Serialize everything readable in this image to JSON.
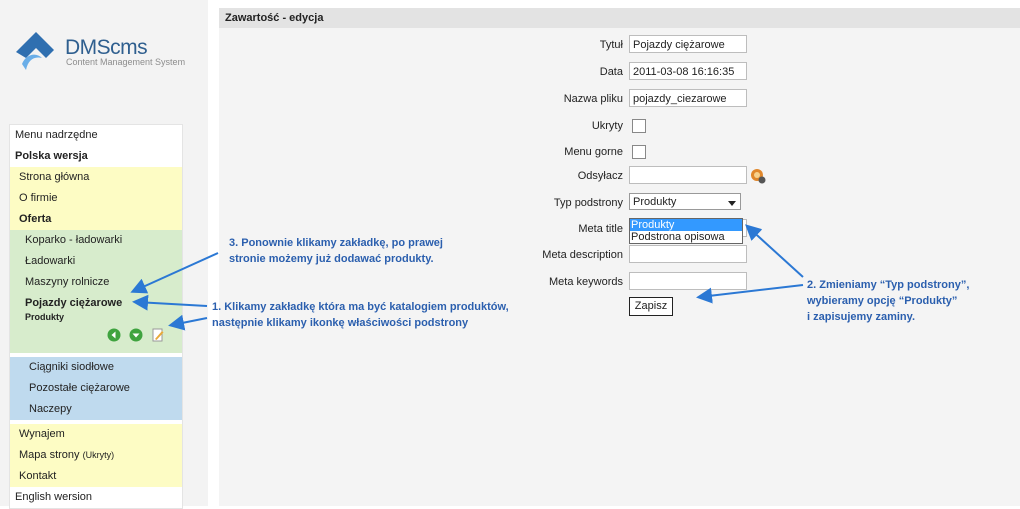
{
  "logo": {
    "name": "DMScms",
    "tagline": "Content Management System"
  },
  "menu": {
    "parent": "Menu nadrzędne",
    "section": "Polska wersja",
    "items_top": [
      {
        "label": "Strona główna"
      },
      {
        "label": "O firmie"
      }
    ],
    "oferta": "Oferta",
    "oferta_items": [
      {
        "label": "Koparko - ładowarki"
      },
      {
        "label": "Ładowarki"
      },
      {
        "label": "Maszyny rolnicze"
      }
    ],
    "selected": {
      "label": "Pojazdy ciężarowe",
      "sub": "Produkty"
    },
    "sub_items": [
      {
        "label": "Ciągniki siodłowe"
      },
      {
        "label": "Pozostałe ciężarowe"
      },
      {
        "label": "Naczepy"
      }
    ],
    "items_bottom": [
      {
        "label": "Wynajem"
      },
      {
        "label": "Mapa strony"
      },
      {
        "label": "Kontakt"
      }
    ],
    "hidden_note": "(Ukryty)",
    "english": "English wersion"
  },
  "form": {
    "header": "Zawartość - edycja",
    "fields": {
      "title_label": "Tytuł",
      "title_value": "Pojazdy ciężarowe",
      "date_label": "Data",
      "date_value": "2011-03-08 16:16:35",
      "file_label": "Nazwa pliku",
      "file_value": "pojazdy_ciezarowe",
      "hidden_label": "Ukryty",
      "topmenu_label": "Menu gorne",
      "link_label": "Odsyłacz",
      "link_value": "",
      "type_label": "Typ podstrony",
      "type_value": "Produkty",
      "meta_title_label": "Meta title",
      "meta_desc_label": "Meta description",
      "meta_kw_label": "Meta keywords"
    },
    "type_options": [
      "Produkty",
      "Podstrona opisowa"
    ],
    "save_label": "Zapisz"
  },
  "annotations": {
    "a1_line1": "1. Klikamy zakładkę która ma być katalogiem produktów,",
    "a1_line2": "następnie klikamy ikonkę właściwości podstrony",
    "a2_line1": "2. Zmieniamy “Typ podstrony”,",
    "a2_line2": "wybieramy opcję “Produkty”",
    "a2_line3": "i zapisujemy zaminy.",
    "a3_line1": "3. Ponownie klikamy zakładkę, po prawej",
    "a3_line2": "stronie możemy już dodawać produkty."
  },
  "colors": {
    "annotation": "#2b5fae",
    "menu_yellow": "#fdfcc4",
    "menu_green": "#d7eccc",
    "menu_blue": "#bfdaee",
    "highlight": "#3399ff"
  }
}
